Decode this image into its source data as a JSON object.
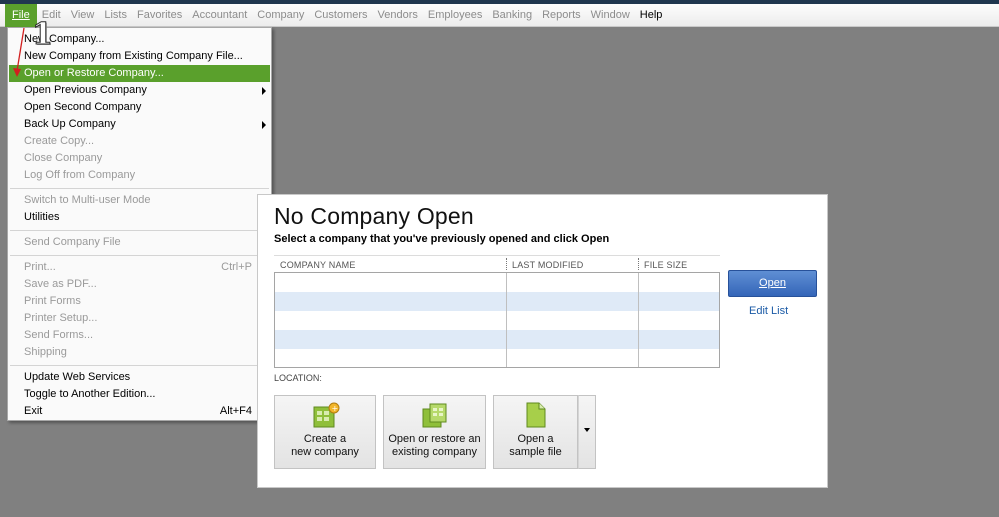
{
  "menubar": [
    {
      "label": "File",
      "state": "active"
    },
    {
      "label": "Edit",
      "state": "disabled"
    },
    {
      "label": "View",
      "state": "disabled"
    },
    {
      "label": "Lists",
      "state": "disabled"
    },
    {
      "label": "Favorites",
      "state": "disabled"
    },
    {
      "label": "Accountant",
      "state": "disabled"
    },
    {
      "label": "Company",
      "state": "disabled"
    },
    {
      "label": "Customers",
      "state": "disabled"
    },
    {
      "label": "Vendors",
      "state": "disabled"
    },
    {
      "label": "Employees",
      "state": "disabled"
    },
    {
      "label": "Banking",
      "state": "disabled"
    },
    {
      "label": "Reports",
      "state": "disabled"
    },
    {
      "label": "Window",
      "state": "disabled"
    },
    {
      "label": "Help",
      "state": "enabled"
    }
  ],
  "annotation": {
    "step_number": "1"
  },
  "file_menu": {
    "items": [
      {
        "label": "New Company...",
        "disabled": false
      },
      {
        "label": "New Company from Existing Company File...",
        "disabled": false
      },
      {
        "label": "Open or Restore Company...",
        "disabled": false,
        "highlight": true
      },
      {
        "label": "Open Previous Company",
        "disabled": false,
        "submenu": true
      },
      {
        "label": "Open Second Company",
        "disabled": false
      },
      {
        "label": "Back Up Company",
        "disabled": false,
        "submenu": true
      },
      {
        "label": "Create Copy...",
        "disabled": true
      },
      {
        "label": "Close Company",
        "disabled": true
      },
      {
        "label": "Log Off from Company",
        "disabled": true
      },
      {
        "label": "Switch to Multi-user Mode",
        "disabled": true
      },
      {
        "label": "Utilities",
        "disabled": false,
        "submenu": true
      },
      {
        "label": "Send Company File",
        "disabled": true,
        "submenu": true
      },
      {
        "label": "Print...",
        "disabled": true,
        "shortcut": "Ctrl+P"
      },
      {
        "label": "Save as PDF...",
        "disabled": true
      },
      {
        "label": "Print Forms",
        "disabled": true,
        "submenu": true
      },
      {
        "label": "Printer Setup...",
        "disabled": true
      },
      {
        "label": "Send Forms...",
        "disabled": true
      },
      {
        "label": "Shipping",
        "disabled": true,
        "submenu": true
      },
      {
        "label": "Update Web Services",
        "disabled": false
      },
      {
        "label": "Toggle to Another Edition...",
        "disabled": false
      },
      {
        "label": "Exit",
        "disabled": false,
        "shortcut": "Alt+F4"
      }
    ]
  },
  "panel": {
    "title": "No Company Open",
    "subtitle": "Select a company that you've previously opened and click Open",
    "columns": [
      "COMPANY NAME",
      "LAST MODIFIED",
      "FILE SIZE"
    ],
    "open_button": "Open",
    "edit_list": "Edit List",
    "location_label": "LOCATION:",
    "actions": [
      {
        "line1": "Create a",
        "line2": "new company"
      },
      {
        "line1": "Open or restore an",
        "line2": "existing company"
      },
      {
        "line1": "Open a",
        "line2": "sample file"
      }
    ]
  },
  "colors": {
    "highlight_green": "#5aa02c",
    "open_button_blue": "#3f72c4",
    "link_blue": "#1a5aa6",
    "row_alt_blue": "#dfeaf7",
    "desktop_gray": "#808080"
  }
}
